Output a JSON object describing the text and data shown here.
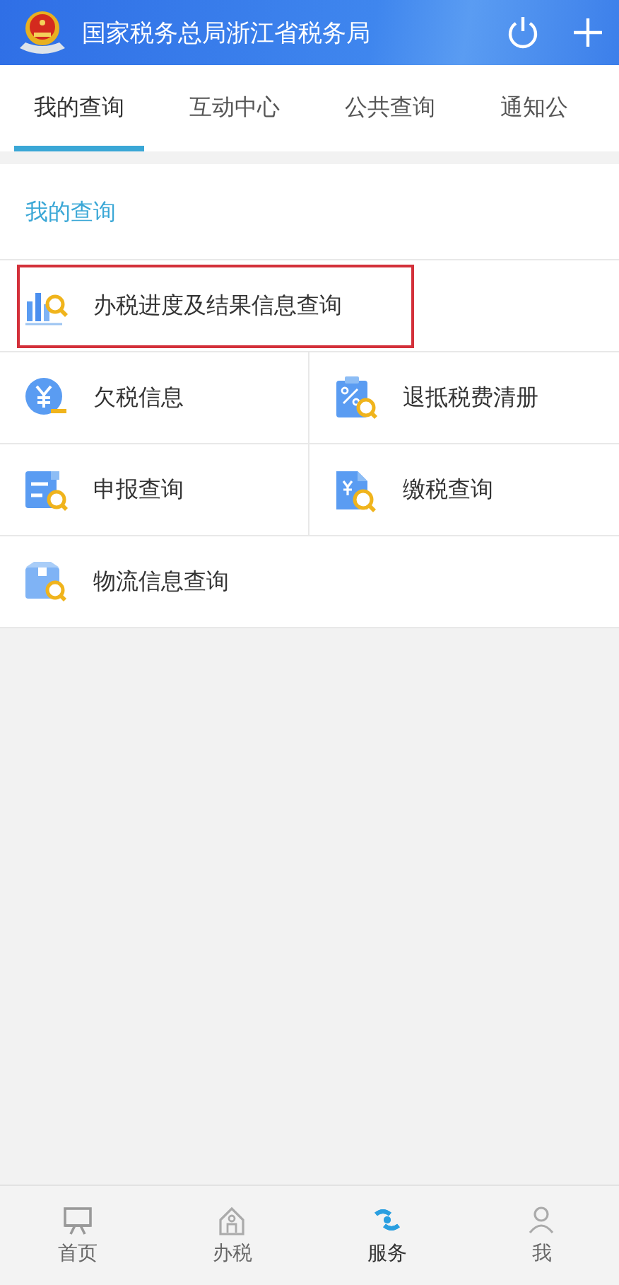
{
  "header": {
    "title": "国家税务总局浙江省税务局"
  },
  "tabs": [
    {
      "label": "我的查询",
      "selected": true
    },
    {
      "label": "互动中心",
      "selected": false
    },
    {
      "label": "公共查询",
      "selected": false
    },
    {
      "label": "通知公",
      "selected": false
    }
  ],
  "section": {
    "title": "我的查询"
  },
  "items": [
    {
      "label": "办税进度及结果信息查询",
      "kind": "wide",
      "highlighted": true
    },
    {
      "label": "欠税信息",
      "kind": "half",
      "highlighted": false
    },
    {
      "label": "退抵税费清册",
      "kind": "half",
      "highlighted": false
    },
    {
      "label": "申报查询",
      "kind": "half",
      "highlighted": false
    },
    {
      "label": "缴税查询",
      "kind": "half",
      "highlighted": false
    },
    {
      "label": "物流信息查询",
      "kind": "wide",
      "highlighted": false
    }
  ],
  "bottom_nav": [
    {
      "label": "首页",
      "selected": false
    },
    {
      "label": "办税",
      "selected": false
    },
    {
      "label": "服务",
      "selected": true
    },
    {
      "label": "我",
      "selected": false
    }
  ]
}
